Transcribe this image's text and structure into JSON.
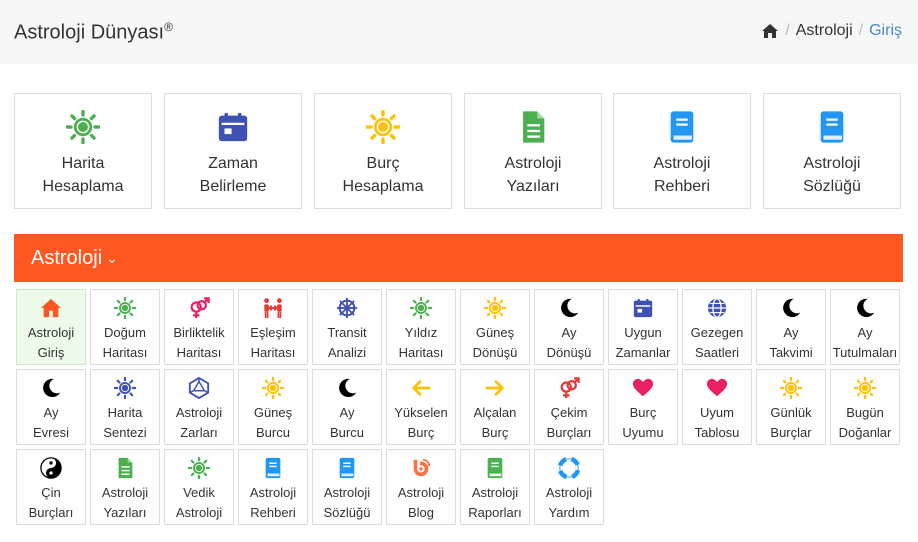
{
  "header": {
    "title": "Astroloji Dünyası",
    "registered": "®",
    "breadcrumb": {
      "sep": "/",
      "items": [
        "Astroloji",
        "Giriş"
      ]
    }
  },
  "features": [
    {
      "label": "Harita\nHesaplama",
      "icon": "sun-icon",
      "color": "#4caf50"
    },
    {
      "label": "Zaman\nBelirleme",
      "icon": "calendar-icon",
      "color": "#3f51b5"
    },
    {
      "label": "Burç\nHesaplama",
      "icon": "sun-icon",
      "color": "#ffc107"
    },
    {
      "label": "Astroloji\nYazıları",
      "icon": "document-icon",
      "color": "#4caf50"
    },
    {
      "label": "Astroloji\nRehberi",
      "icon": "book-icon",
      "color": "#2196f3"
    },
    {
      "label": "Astroloji\nSözlüğü",
      "icon": "book-icon",
      "color": "#2196f3"
    }
  ],
  "section": {
    "title": "Astroloji",
    "accent": "#ff5722"
  },
  "tiles": [
    {
      "label": "Astroloji\nGiriş",
      "icon": "home-icon",
      "color": "#ff5722",
      "active": true
    },
    {
      "label": "Doğum\nHaritası",
      "icon": "sun-icon",
      "color": "#4caf50"
    },
    {
      "label": "Birliktelik\nHaritası",
      "icon": "venus-mars-icon",
      "color": "#e91e63"
    },
    {
      "label": "Eşleşim\nHaritası",
      "icon": "couple-icon",
      "color": "#e53935"
    },
    {
      "label": "Transit\nAnalizi",
      "icon": "wheel-icon",
      "color": "#3f51b5"
    },
    {
      "label": "Yıldız\nHaritası",
      "icon": "sun-icon",
      "color": "#4caf50"
    },
    {
      "label": "Güneş\nDönüşü",
      "icon": "sun-icon",
      "color": "#ffc107"
    },
    {
      "label": "Ay\nDönüşü",
      "icon": "moon-icon",
      "color": "#000000"
    },
    {
      "label": "Uygun\nZamanlar",
      "icon": "calendar-icon",
      "color": "#3f51b5"
    },
    {
      "label": "Gezegen\nSaatleri",
      "icon": "globe-icon",
      "color": "#3f51b5"
    },
    {
      "label": "Ay\nTakvimi",
      "icon": "moon-icon",
      "color": "#000000"
    },
    {
      "label": "Ay\nTutulmaları",
      "icon": "moon-icon",
      "color": "#000000"
    },
    {
      "label": "Ay\nEvresi",
      "icon": "moon-icon",
      "color": "#000000"
    },
    {
      "label": "Harita\nSentezi",
      "icon": "sun-icon",
      "color": "#3f51b5"
    },
    {
      "label": "Astroloji\nZarları",
      "icon": "dice-icon",
      "color": "#3f51b5"
    },
    {
      "label": "Güneş\nBurcu",
      "icon": "sun-icon",
      "color": "#ffc107"
    },
    {
      "label": "Ay\nBurcu",
      "icon": "moon-icon",
      "color": "#000000"
    },
    {
      "label": "Yükselen\nBurç",
      "icon": "arrow-left-icon",
      "color": "#ffc107"
    },
    {
      "label": "Alçalan\nBurç",
      "icon": "arrow-right-icon",
      "color": "#ffc107"
    },
    {
      "label": "Çekim\nBurçları",
      "icon": "venus-mars-icon",
      "color": "#e53935"
    },
    {
      "label": "Burç\nUyumu",
      "icon": "heart-icon",
      "color": "#e91e63"
    },
    {
      "label": "Uyum\nTablosu",
      "icon": "heart-icon",
      "color": "#e91e63"
    },
    {
      "label": "Günlük\nBurçlar",
      "icon": "sun-icon",
      "color": "#ffc107"
    },
    {
      "label": "Bugün\nDoğanlar",
      "icon": "sun-icon",
      "color": "#ffc107"
    },
    {
      "label": "Çin\nBurçları",
      "icon": "yin-yang-icon",
      "color": "#000000"
    },
    {
      "label": "Astroloji\nYazıları",
      "icon": "document-icon",
      "color": "#4caf50"
    },
    {
      "label": "Vedik\nAstroloji",
      "icon": "sun-icon",
      "color": "#4caf50"
    },
    {
      "label": "Astroloji\nRehberi",
      "icon": "book-icon",
      "color": "#2196f3"
    },
    {
      "label": "Astroloji\nSözlüğü",
      "icon": "book-icon",
      "color": "#2196f3"
    },
    {
      "label": "Astroloji\nBlog",
      "icon": "blogger-icon",
      "color": "#ff7043"
    },
    {
      "label": "Astroloji\nRaporları",
      "icon": "book-icon",
      "color": "#4caf50"
    },
    {
      "label": "Astroloji\nYardım",
      "icon": "lifebuoy-icon",
      "color": "#2196f3"
    }
  ]
}
